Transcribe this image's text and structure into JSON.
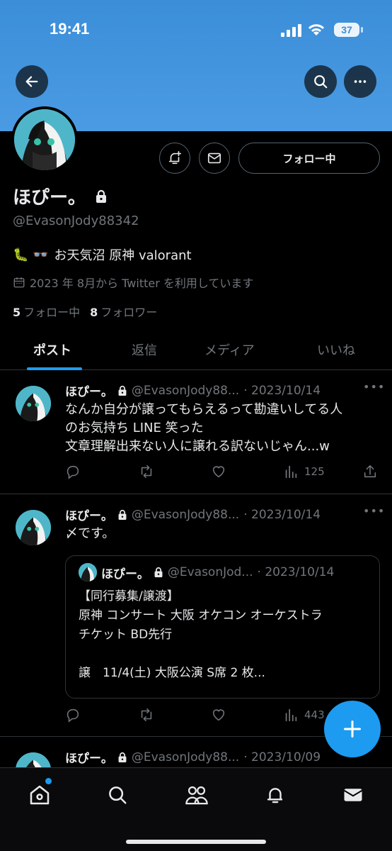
{
  "status_bar": {
    "time": "19:41",
    "battery": "37"
  },
  "profile": {
    "name": "ほぴー。",
    "handle": "@EvasonJody88342",
    "bio_emoji": "🐛 👓",
    "bio": "お天気沼 原神 valorant",
    "joined": "2023 年 8月から Twitter を利用しています",
    "following_count": "5",
    "following_label": "フォロー中",
    "followers_count": "8",
    "followers_label": "フォロワー",
    "follow_button": "フォロー中"
  },
  "tabs": [
    "ポスト",
    "返信",
    "メディア",
    "いいね"
  ],
  "posts": [
    {
      "name": "ほぴー。",
      "handle": "@EvasonJody88...",
      "date": "· 2023/10/14",
      "text": "なんか自分が譲ってもらえるって勘違いしてる人\nのお気持ち LINE 笑った\n文章理解出来ない人に譲れる訳ないじゃん...w",
      "views": "125"
    },
    {
      "name": "ほぴー。",
      "handle": "@EvasonJody88...",
      "date": "· 2023/10/14",
      "text": "〆です。",
      "views": "443",
      "quote": {
        "name": "ほぴー。",
        "handle": "@EvasonJod...",
        "date": "· 2023/10/14",
        "text": "【同行募集/譲渡】\n原神 コンサート 大阪 オケコン オーケストラ\nチケット BD先行\n\n譲　11/4(土) 大阪公演 S席 2 枚..."
      }
    },
    {
      "name": "ほぴー。",
      "handle": "@EvasonJody88...",
      "date": "· 2023/10/09"
    }
  ],
  "colors": {
    "accent": "#1d9bf0",
    "banner": "#4a9be3",
    "muted": "#71767b"
  },
  "icons": [
    "back-arrow-icon",
    "search-icon",
    "more-icon",
    "bell-plus-icon",
    "mail-icon",
    "lock-icon",
    "calendar-icon",
    "reply-icon",
    "retweet-icon",
    "like-icon",
    "views-icon",
    "share-icon",
    "home-icon",
    "people-icon",
    "bell-icon",
    "envelope-icon",
    "plus-icon"
  ]
}
